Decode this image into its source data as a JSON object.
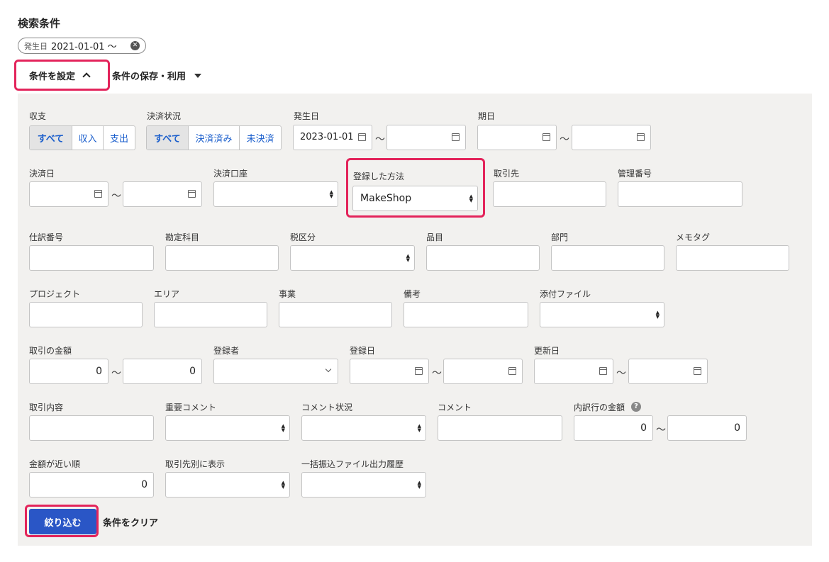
{
  "title": "検索条件",
  "chip": {
    "label": "発生日",
    "value": "2021-01-01 〜"
  },
  "set_conditions": "条件を設定",
  "save_conditions": "条件の保存・利用",
  "row1": {
    "income_label": "収支",
    "income_options": [
      "すべて",
      "収入",
      "支出"
    ],
    "status_label": "決済状況",
    "status_options": [
      "すべて",
      "決済済み",
      "未決済"
    ],
    "date_label": "発生日",
    "date_from": "2023-01-01",
    "period_label": "期日"
  },
  "row2": {
    "settle_date_label": "決済日",
    "account_label": "決済口座",
    "method_label": "登録した方法",
    "method_value": "MakeShop",
    "partner_label": "取引先",
    "mgmt_label": "管理番号"
  },
  "row3": {
    "journal_label": "仕訳番号",
    "account_item_label": "勘定科目",
    "tax_label": "税区分",
    "item_label": "品目",
    "dept_label": "部門",
    "memo_label": "メモタグ"
  },
  "row4": {
    "project_label": "プロジェクト",
    "area_label": "エリア",
    "business_label": "事業",
    "note_label": "備考",
    "attach_label": "添付ファイル"
  },
  "row5": {
    "amount_label": "取引の金額",
    "amount_from": "0",
    "amount_to": "0",
    "registrant_label": "登録者",
    "reg_date_label": "登録日",
    "update_label": "更新日"
  },
  "row6": {
    "content_label": "取引内容",
    "important_label": "重要コメント",
    "comment_status_label": "コメント状況",
    "comment_label": "コメント",
    "detail_amount_label": "内訳行の金額",
    "detail_from": "0",
    "detail_to": "0",
    "help": "?"
  },
  "row7": {
    "near_label": "金額が近い順",
    "near_value": "0",
    "by_partner_label": "取引先別に表示",
    "bulk_label": "一括振込ファイル出力履歴"
  },
  "tilde": "〜",
  "filter_button": "絞り込む",
  "clear_button": "条件をクリア",
  "accent_color": "#e3245b",
  "primary_color": "#2a56c6"
}
